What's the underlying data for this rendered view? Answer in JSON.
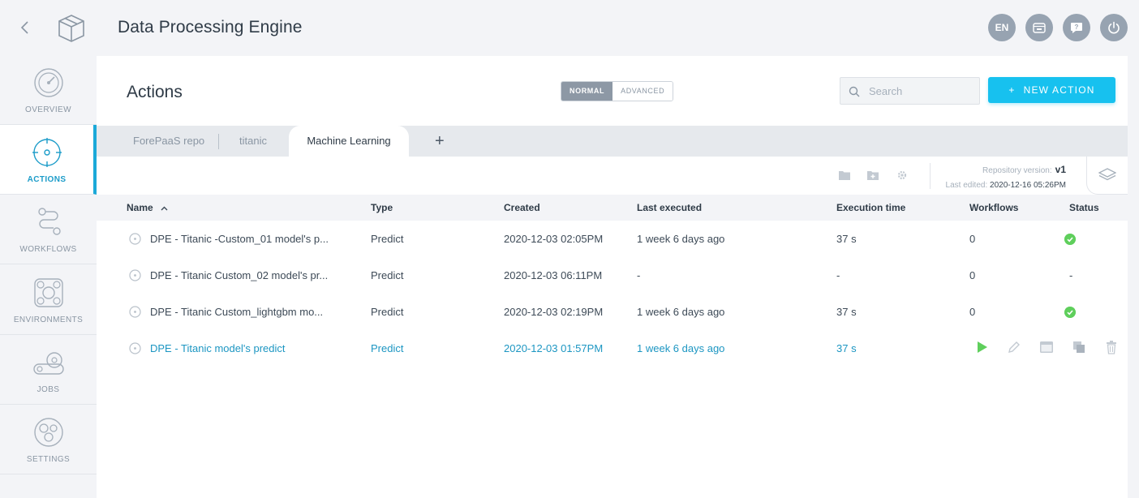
{
  "app": {
    "title": "Data Processing Engine",
    "language": "EN"
  },
  "sidebar": {
    "items": [
      {
        "label": "OVERVIEW",
        "icon": "gauge-icon"
      },
      {
        "label": "ACTIONS",
        "icon": "target-icon",
        "active": true
      },
      {
        "label": "WORKFLOWS",
        "icon": "workflow-icon"
      },
      {
        "label": "ENVIRONMENTS",
        "icon": "environment-icon"
      },
      {
        "label": "JOBS",
        "icon": "gears-icon"
      },
      {
        "label": "SETTINGS",
        "icon": "settings-icon"
      }
    ]
  },
  "header": {
    "title": "Actions",
    "mode_normal": "NORMAL",
    "mode_advanced": "ADVANCED",
    "search_placeholder": "Search",
    "new_action_label": "NEW ACTION"
  },
  "tabs": {
    "items": [
      "ForePaaS repo",
      "titanic",
      "Machine Learning"
    ],
    "active_index": 2
  },
  "repo": {
    "version_label": "Repository version:",
    "version": "v1",
    "last_edited_label": "Last edited:",
    "last_edited": "2020-12-16 05:26PM"
  },
  "table": {
    "columns": [
      "Name",
      "Type",
      "Created",
      "Last executed",
      "Execution time",
      "Workflows",
      "Status"
    ],
    "rows": [
      {
        "name": "DPE - Titanic -Custom_01 model's p...",
        "type": "Predict",
        "created": "2020-12-03 02:05PM",
        "last_executed": "1 week 6 days ago",
        "exec_time": "37 s",
        "workflows": "0",
        "status": "success"
      },
      {
        "name": "DPE - Titanic Custom_02 model's pr...",
        "type": "Predict",
        "created": "2020-12-03 06:11PM",
        "last_executed": "-",
        "exec_time": "-",
        "workflows": "0",
        "status": "-"
      },
      {
        "name": "DPE - Titanic Custom_lightgbm mo...",
        "type": "Predict",
        "created": "2020-12-03 02:19PM",
        "last_executed": "1 week 6 days ago",
        "exec_time": "37 s",
        "workflows": "0",
        "status": "success"
      },
      {
        "name": "DPE - Titanic model's predict",
        "type": "Predict",
        "created": "2020-12-03 01:57PM",
        "last_executed": "1 week 6 days ago",
        "exec_time": "37 s",
        "workflows": "",
        "status": ""
      }
    ]
  },
  "colors": {
    "accent": "#17c1ef",
    "active_nav": "#1ba9d8",
    "success": "#5fcf5c",
    "hover_text": "#1c96c2"
  }
}
